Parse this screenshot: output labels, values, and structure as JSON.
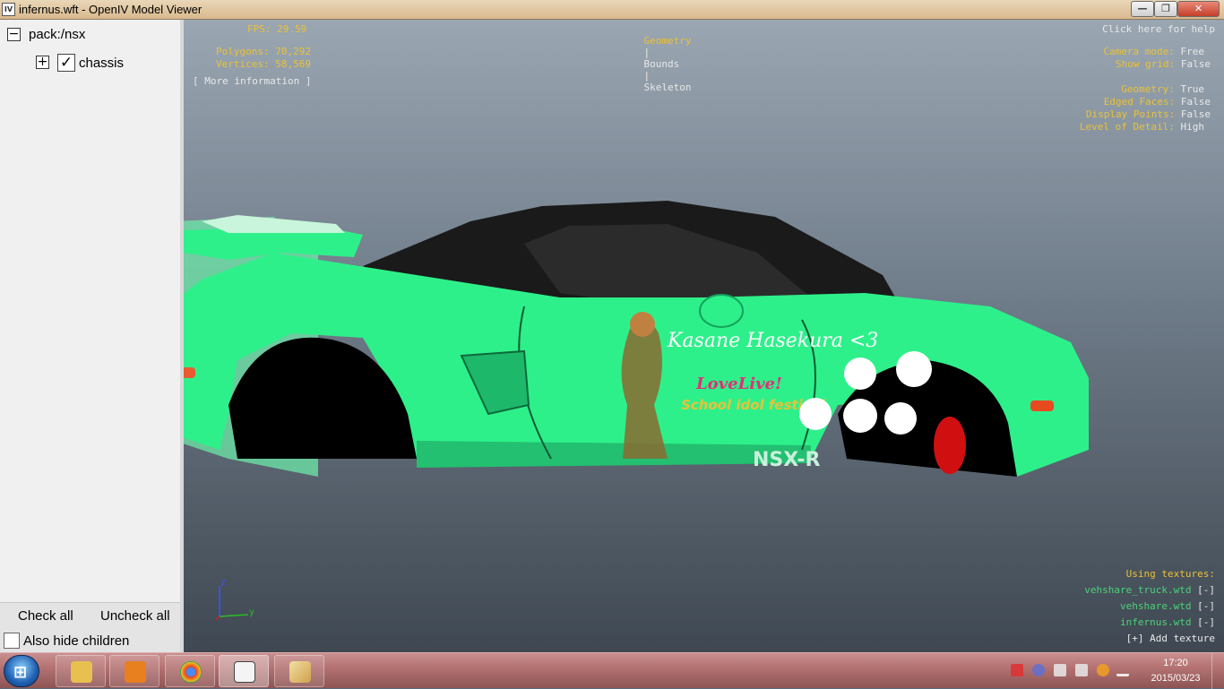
{
  "window": {
    "title": "infernus.wft - OpenIV Model Viewer",
    "icon_text": "IV"
  },
  "sidebar": {
    "root_label": "pack:/nsx",
    "child_label": "chassis",
    "check_all": "Check all",
    "uncheck_all": "Uncheck all",
    "hide_children": "Also hide children"
  },
  "hud": {
    "fps_label": "FPS:",
    "fps_value": "29.59",
    "polygons_label": "Polygons:",
    "polygons_value": "70,292",
    "vertices_label": "Vertices:",
    "vertices_value": "58,569",
    "more_info": "[ More information ]",
    "tabs": [
      "Geometry",
      "Bounds",
      "Skeleton"
    ],
    "tab_separator": "|",
    "help": "Click here for help",
    "camera_label": "Camera mode:",
    "camera_value": "Free",
    "grid_label": "Show grid:",
    "grid_value": "False",
    "geometry_label": "Geometry:",
    "geometry_value": "True",
    "edged_label": "Edged Faces:",
    "edged_value": "False",
    "points_label": "Display Points:",
    "points_value": "False",
    "lod_label": "Level of Detail:",
    "lod_value": "High",
    "textures_title": "Using textures:",
    "textures": [
      "vehshare_truck.wtd",
      "vehshare.wtd",
      "infernus.wtd"
    ],
    "remove_label": "[-]",
    "add_texture": "[+] Add texture",
    "axis_z": "z",
    "axis_y": "y"
  },
  "car": {
    "decal_name": "Kasane Hasekura <3",
    "decal_logo_1": "LoveLive!",
    "decal_logo_2": "School idol festival",
    "badge": "NSX-R",
    "body_color": "#2ef08a",
    "dark_color": "#1a1a1a"
  },
  "taskbar": {
    "clock_time": "17:20",
    "clock_date": "2015/03/23",
    "apps": [
      "explorer-icon",
      "media-player-icon",
      "chrome-icon",
      "openiv-icon",
      "paint-icon"
    ]
  }
}
